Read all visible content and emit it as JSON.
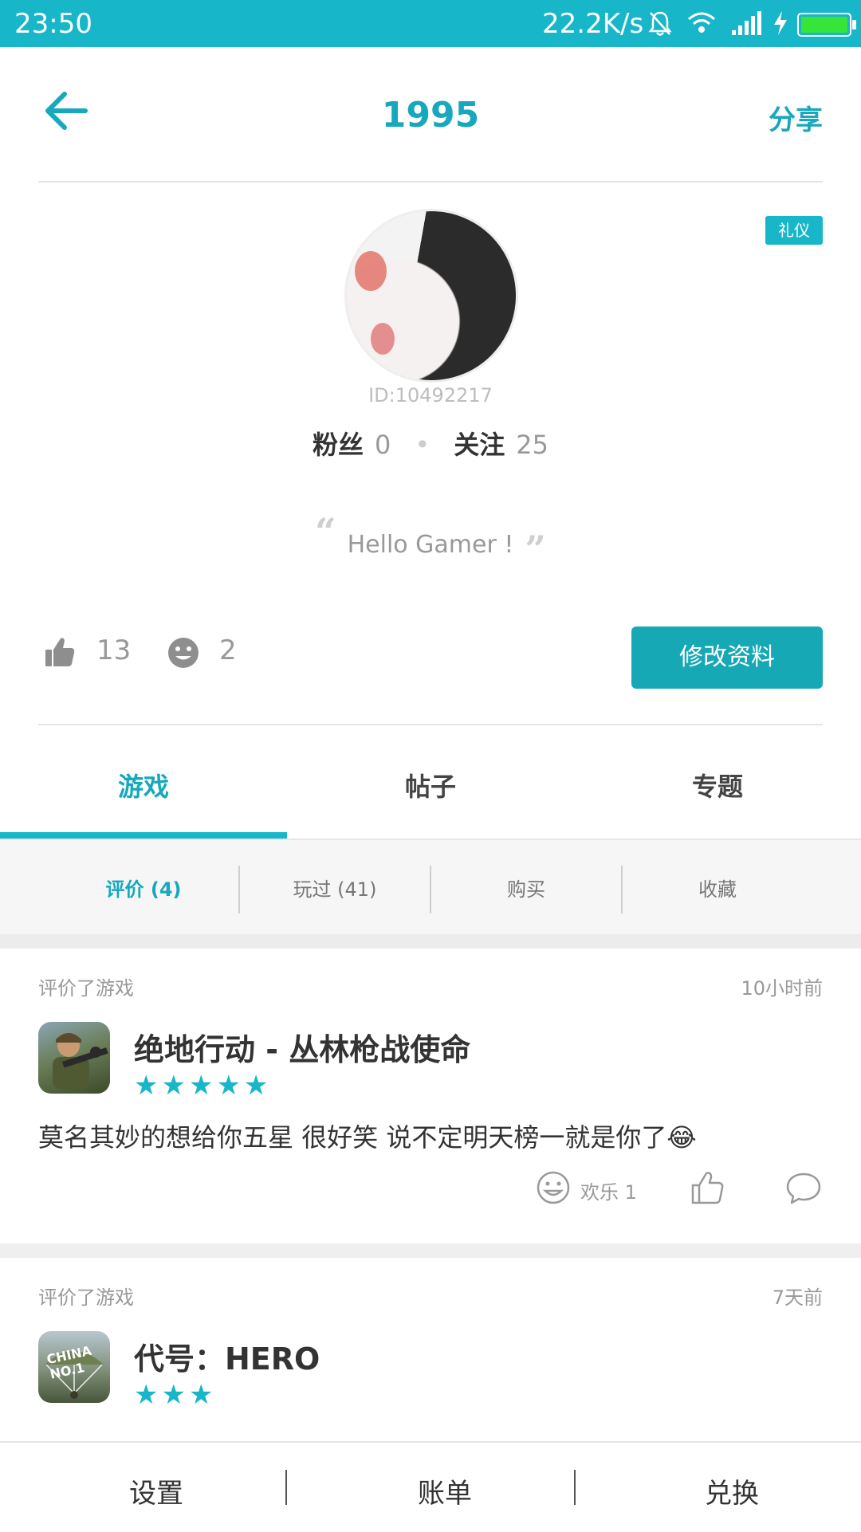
{
  "status": {
    "time": "23:50",
    "net_speed": "22.2K/s",
    "icons": [
      "mute-bell-icon",
      "wifi-icon",
      "signal-icon",
      "charging-icon",
      "battery-icon"
    ]
  },
  "header": {
    "back_icon": "arrow-left-icon",
    "title": "1995",
    "share_label": "分享"
  },
  "profile": {
    "badge": "礼仪",
    "id_text": "ID:10492217",
    "fans_label": "粉丝",
    "fans_count": "0",
    "follow_label": "关注",
    "follow_count": "25",
    "quote": "Hello Gamer !",
    "likes": "13",
    "smiles": "2",
    "edit_label": "修改资料"
  },
  "tabs": [
    {
      "label": "游戏",
      "active": true
    },
    {
      "label": "帖子",
      "active": false
    },
    {
      "label": "专题",
      "active": false
    }
  ],
  "subtabs": [
    {
      "label": "评价 (4)",
      "active": true
    },
    {
      "label": "玩过 (41)",
      "active": false
    },
    {
      "label": "购买",
      "active": false
    },
    {
      "label": "收藏",
      "active": false
    }
  ],
  "reviews": [
    {
      "kind": "评价了游戏",
      "time": "10小时前",
      "game": "绝地行动 - 丛林枪战使命",
      "stars": "★★★★★",
      "rating": 5,
      "body": "莫名其妙的想给你五星 很好笑 说不定明天榜一就是你了😂",
      "happy_label": "欢乐 1"
    },
    {
      "kind": "评价了游戏",
      "time": "7天前",
      "game": "代号：HERO",
      "stars": "★★★",
      "rating": 3,
      "icon_text": "CHINA NO.1"
    }
  ],
  "bottom_nav": [
    "设置",
    "账单",
    "兑换"
  ],
  "colors": {
    "accent": "#17b6c9",
    "accent_dark": "#17a8b5",
    "battery": "#35e53a"
  }
}
